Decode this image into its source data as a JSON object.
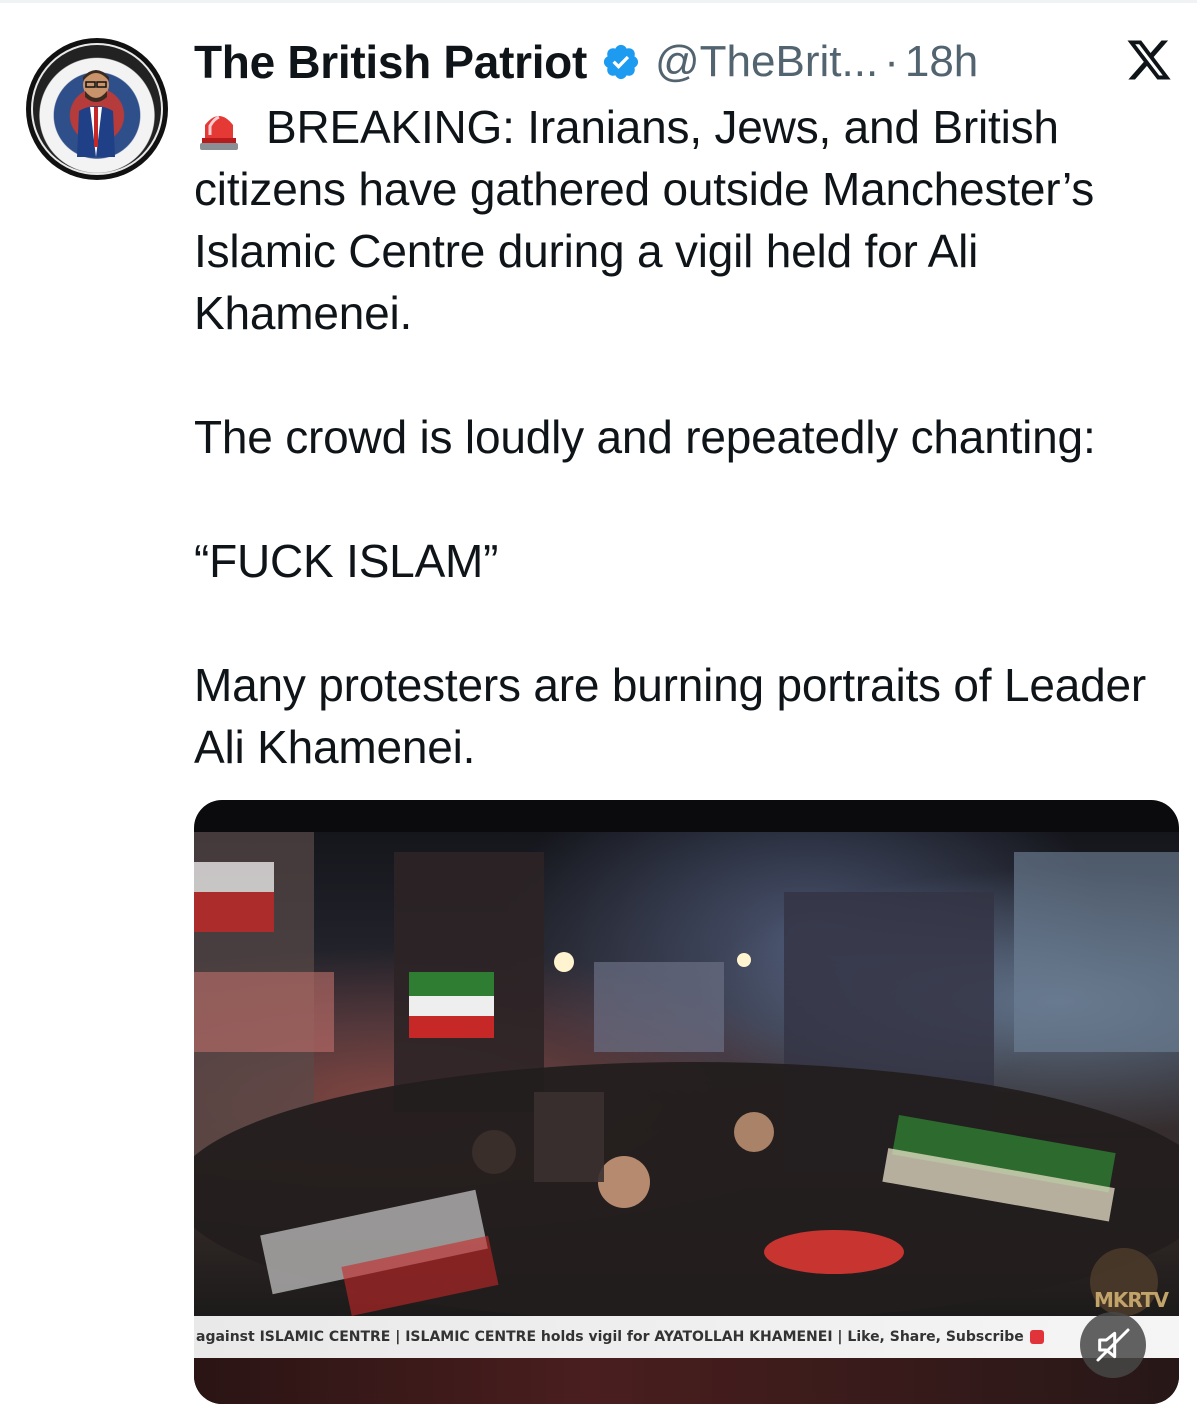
{
  "post": {
    "author_name": "The British Patriot",
    "handle": "@TheBrit...",
    "separator": "·",
    "time": "18h",
    "paragraphs": [
      "BREAKING: Iranians, Jews, and British citizens have gathered outside Manchester’s Islamic Centre during a vigil held for Ali Khamenei.",
      "The crowd is loudly and repeatedly chanting:",
      "“FUCK ISLAM”",
      "Many protesters are burning portraits of Leader Ali Khamenei."
    ]
  },
  "media": {
    "ticker_text": "against ISLAMIC CENTRE | ISLAMIC CENTRE holds vigil for AYATOLLAH KHAMENEI | Like, Share, Subscribe",
    "watermark": "MKRTV"
  },
  "icons": {
    "verified": "verified-badge-icon",
    "platform": "x-logo-icon",
    "siren": "siren-emoji-icon",
    "mute": "muted-speaker-icon"
  },
  "colors": {
    "text": "#0f1419",
    "secondary": "#536471",
    "verified_blue": "#1d9bf0"
  }
}
